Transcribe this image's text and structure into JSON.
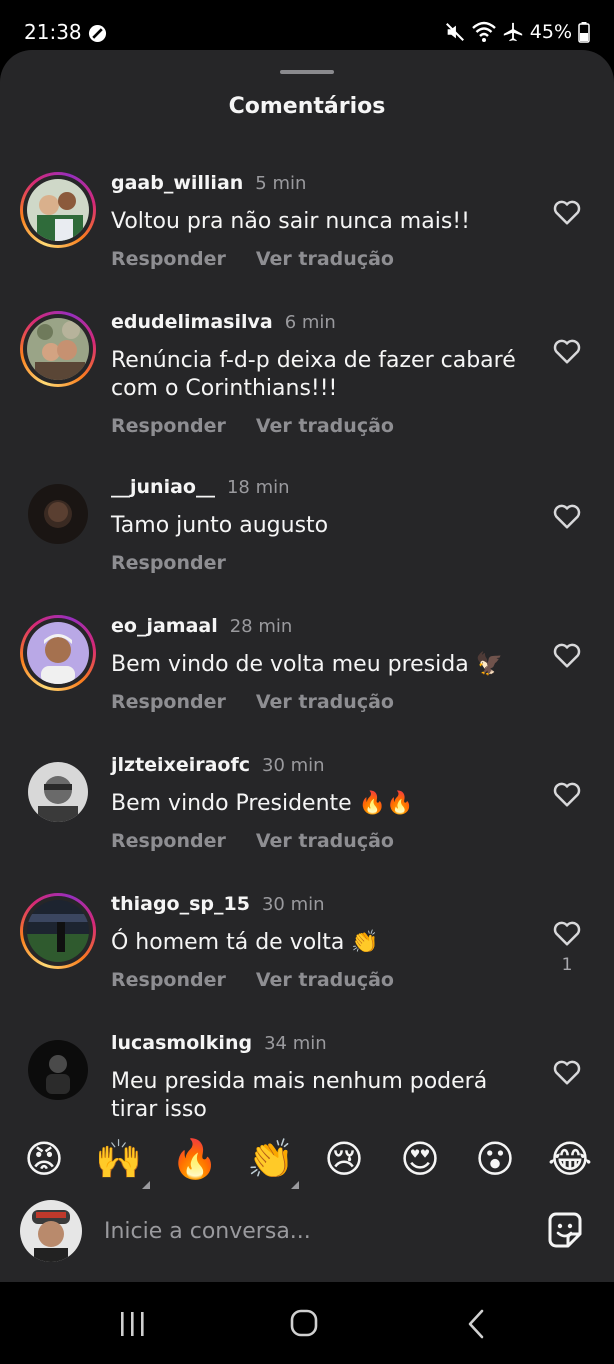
{
  "status_bar": {
    "time": "21:38",
    "battery": "45%"
  },
  "sheet": {
    "title": "Comentários"
  },
  "comments": [
    {
      "username": "gaab_willian",
      "time": "5 min",
      "text": "Voltou pra não sair nunca mais!!",
      "reply_label": "Responder",
      "translate_label": "Ver tradução",
      "likes": ""
    },
    {
      "username": "edudelimasilva",
      "time": "6 min",
      "text": "Renúncia f-d-p deixa de fazer cabaré com o Corinthians!!!",
      "reply_label": "Responder",
      "translate_label": "Ver tradução",
      "likes": ""
    },
    {
      "username": "__juniao__",
      "time": "18 min",
      "text": "Tamo junto augusto",
      "reply_label": "Responder",
      "translate_label": "",
      "likes": ""
    },
    {
      "username": "eo_jamaal",
      "time": "28 min",
      "text": "Bem vindo de volta meu presida 🦅",
      "reply_label": "Responder",
      "translate_label": "Ver tradução",
      "likes": ""
    },
    {
      "username": "jlzteixeiraofc",
      "time": "30 min",
      "text": "Bem vindo Presidente 🔥🔥",
      "reply_label": "Responder",
      "translate_label": "Ver tradução",
      "likes": ""
    },
    {
      "username": "thiago_sp_15",
      "time": "30 min",
      "text": "Ó homem tá de volta 👏",
      "reply_label": "Responder",
      "translate_label": "Ver tradução",
      "likes": "1"
    },
    {
      "username": "lucasmolking",
      "time": "34 min",
      "text": "Meu presida mais nenhum poderá tirar isso",
      "reply_label": "",
      "translate_label": "",
      "likes": ""
    }
  ],
  "emoji_reactions": [
    "😡",
    "🙌",
    "🔥",
    "👏",
    "😢",
    "😍",
    "😮",
    "😂"
  ],
  "composer": {
    "placeholder": "Inicie a conversa..."
  },
  "icons": {
    "dnd": "do-not-disturb-icon",
    "mute": "muted-icon",
    "wifi": "wifi-icon",
    "airplane": "airplane-icon",
    "battery": "battery-icon",
    "like": "heart-icon",
    "sticker": "sticker-icon",
    "recents": "recents-icon",
    "home": "home-icon",
    "back": "back-icon"
  },
  "colors": {
    "sheet_background": "#262628",
    "text_primary": "#f5f5f5",
    "text_secondary": "#8e8e92"
  }
}
